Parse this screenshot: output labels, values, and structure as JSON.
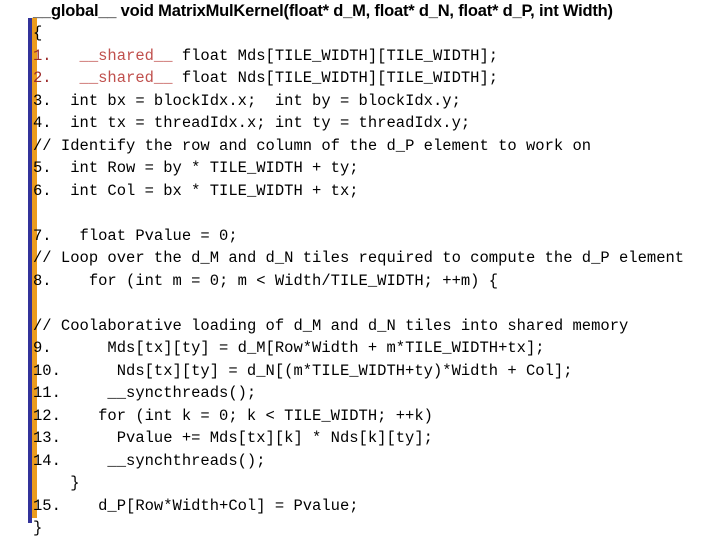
{
  "slide": {
    "background_color": "#ffffff",
    "accent_bar_colors": {
      "inner_blue": "#33339a",
      "outer_orange": "#eb9c1e"
    },
    "text_color": "#000000",
    "line_number_highlight_color": "#9c2c2c",
    "keyword_color": "#c0504d"
  },
  "signature": {
    "text": "__global__ void MatrixMulKernel(float* d_M, float* d_N, float* d_P, int Width)"
  },
  "code": {
    "language": "CUDA C",
    "lines": [
      {
        "id": "line-open-brace",
        "number": "",
        "text": "{",
        "style": "plain"
      },
      {
        "id": "line-1",
        "number": "1.",
        "text": "   __shared__ float Mds[TILE_WIDTH][TILE_WIDTH];",
        "style": "shared"
      },
      {
        "id": "line-2",
        "number": "2.",
        "text": "   __shared__ float Nds[TILE_WIDTH][TILE_WIDTH];",
        "style": "shared"
      },
      {
        "id": "line-3",
        "number": "3.",
        "text": "  int bx = blockIdx.x;  int by = blockIdx.y;",
        "style": "plain"
      },
      {
        "id": "line-4",
        "number": "4.",
        "text": "  int tx = threadIdx.x; int ty = threadIdx.y;",
        "style": "plain"
      },
      {
        "id": "line-comment-1",
        "number": "//",
        "text": " Identify the row and column of the d_P element to work on",
        "style": "comment"
      },
      {
        "id": "line-5",
        "number": "5.",
        "text": "  int Row = by * TILE_WIDTH + ty;",
        "style": "plain"
      },
      {
        "id": "line-6",
        "number": "6.",
        "text": "  int Col = bx * TILE_WIDTH + tx;",
        "style": "plain"
      },
      {
        "id": "line-blank-1",
        "number": "",
        "text": "",
        "style": "blank"
      },
      {
        "id": "line-7",
        "number": "7.",
        "text": "   float Pvalue = 0;",
        "style": "plain"
      },
      {
        "id": "line-comment-2",
        "number": "//",
        "text": " Loop over the d_M and d_N tiles required to compute the d_P element",
        "style": "comment"
      },
      {
        "id": "line-8",
        "number": "8.",
        "text": "    for (int m = 0; m < Width/TILE_WIDTH; ++m) {",
        "style": "plain"
      },
      {
        "id": "line-blank-2",
        "number": "",
        "text": "",
        "style": "blank"
      },
      {
        "id": "line-comment-3",
        "number": "//",
        "text": " Coolaborative loading of d_M and d_N tiles into shared memory",
        "style": "comment"
      },
      {
        "id": "line-9",
        "number": "9.",
        "text": "      Mds[tx][ty] = d_M[Row*Width + m*TILE_WIDTH+tx];",
        "style": "plain"
      },
      {
        "id": "line-10",
        "number": "10.",
        "text": "      Nds[tx][ty] = d_N[(m*TILE_WIDTH+ty)*Width + Col];",
        "style": "plain"
      },
      {
        "id": "line-11",
        "number": "11.",
        "text": "     __syncthreads();",
        "style": "plain"
      },
      {
        "id": "line-12",
        "number": "12.",
        "text": "    for (int k = 0; k < TILE_WIDTH; ++k)",
        "style": "plain"
      },
      {
        "id": "line-13",
        "number": "13.",
        "text": "      Pvalue += Mds[tx][k] * Nds[k][ty];",
        "style": "plain"
      },
      {
        "id": "line-14",
        "number": "14.",
        "text": "     __synchthreads();",
        "style": "plain"
      },
      {
        "id": "line-close-inner",
        "number": "",
        "text": "    }",
        "style": "plain"
      },
      {
        "id": "line-15",
        "number": "15.",
        "text": "    d_P[Row*Width+Col] = Pvalue;",
        "style": "plain"
      },
      {
        "id": "line-close-brace",
        "number": "",
        "text": "}",
        "style": "plain"
      }
    ]
  }
}
